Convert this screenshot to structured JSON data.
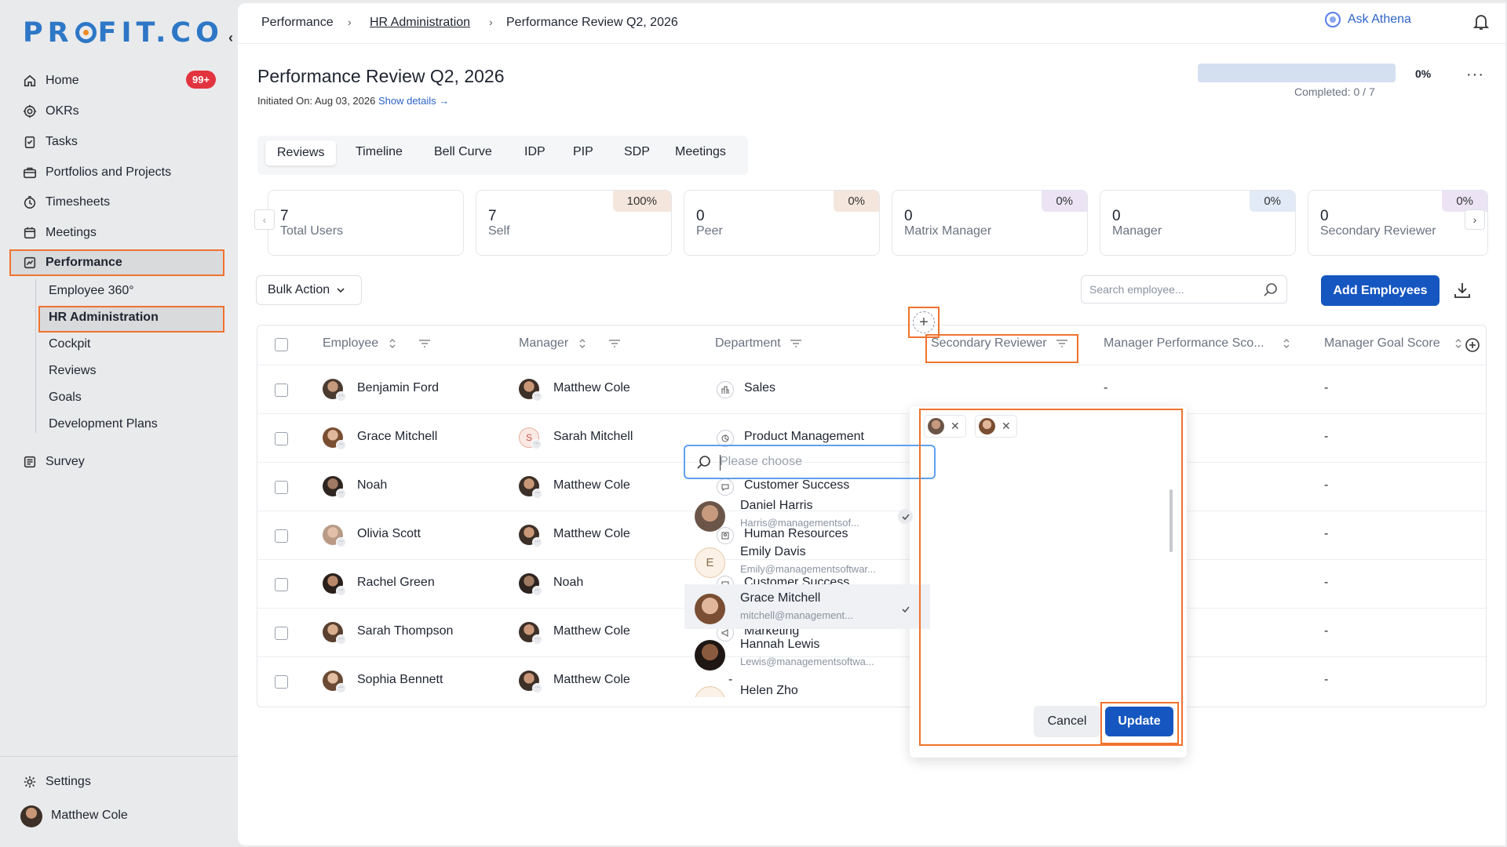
{
  "app": {
    "logo": "PROFIT.CO"
  },
  "sidebar": {
    "home_badge": "99+",
    "items": [
      {
        "label": "Home",
        "icon": "home-icon"
      },
      {
        "label": "OKRs",
        "icon": "target-icon"
      },
      {
        "label": "Tasks",
        "icon": "tasks-icon"
      },
      {
        "label": "Portfolios and Projects",
        "icon": "briefcase-icon"
      },
      {
        "label": "Timesheets",
        "icon": "timer-icon"
      },
      {
        "label": "Meetings",
        "icon": "calendar-icon"
      },
      {
        "label": "Performance",
        "icon": "chart-icon"
      }
    ],
    "sub_items": [
      "Employee 360°",
      "HR Administration",
      "Cockpit",
      "Reviews",
      "Goals",
      "Development Plans"
    ],
    "survey": "Survey",
    "settings": "Settings",
    "user_name": "Matthew Cole"
  },
  "breadcrumb": [
    "Performance",
    "HR Administration",
    "Performance Review Q2, 2026"
  ],
  "topbar": {
    "ask_athena": "Ask Athena"
  },
  "page": {
    "title": "Performance Review Q2, 2026",
    "initiated": "Initiated On: Aug 03, 2026",
    "show_details": "Show details →",
    "progress_pct": "0%",
    "progress_value": 0,
    "completed": "Completed: 0 / 7",
    "more": "···"
  },
  "tabs": [
    "Reviews",
    "Timeline",
    "Bell Curve",
    "IDP",
    "PIP",
    "SDP",
    "Meetings"
  ],
  "cards": [
    {
      "num": "7",
      "label": "Total Users",
      "pct": ""
    },
    {
      "num": "7",
      "label": "Self",
      "pct": "100%",
      "color": "#f4e6dc"
    },
    {
      "num": "0",
      "label": "Peer",
      "pct": "0%",
      "color": "#f4e6dc"
    },
    {
      "num": "0",
      "label": "Matrix Manager",
      "pct": "0%",
      "color": "#ece4f5"
    },
    {
      "num": "0",
      "label": "Manager",
      "pct": "0%",
      "color": "#e1eaf6"
    },
    {
      "num": "0",
      "label": "Secondary Reviewer",
      "pct": "0%",
      "color": "#ece4f5"
    }
  ],
  "toolbar": {
    "bulk_action": "Bulk Action",
    "search_placeholder": "Search employee...",
    "add_employees": "Add Employees"
  },
  "table": {
    "headers": [
      "Employee",
      "Manager",
      "Department",
      "Secondary Reviewer",
      "Manager Performance Sco...",
      "Manager Goal Score"
    ],
    "rows": [
      {
        "employee": "Benjamin Ford",
        "manager": "Matthew Cole",
        "department": "Sales",
        "mps": "-",
        "mgs": "-"
      },
      {
        "employee": "Grace Mitchell",
        "manager": "Sarah Mitchell",
        "department": "Product Management",
        "mps": "",
        "mgs": "-"
      },
      {
        "employee": "Noah",
        "manager": "Matthew Cole",
        "department": "Customer Success",
        "mps": "",
        "mgs": "-"
      },
      {
        "employee": "Olivia Scott",
        "manager": "Matthew Cole",
        "department": "Human Resources",
        "mps": "",
        "mgs": "-"
      },
      {
        "employee": "Rachel Green",
        "manager": "Noah",
        "department": "Customer Success",
        "mps": "",
        "mgs": "-"
      },
      {
        "employee": "Sarah Thompson",
        "manager": "Matthew Cole",
        "department": "Marketing",
        "mps": "",
        "mgs": "-"
      },
      {
        "employee": "Sophia Bennett",
        "manager": "Matthew Cole",
        "department": "-",
        "mps": "",
        "mgs": "-"
      }
    ]
  },
  "dropdown": {
    "placeholder": "Please choose",
    "options": [
      {
        "name": "Daniel Harris",
        "email": "Harris@managementsof...",
        "checked": true
      },
      {
        "name": "Emily Davis",
        "email": "Emily@managementsoftwar...",
        "checked": false,
        "initial": "E"
      },
      {
        "name": "Grace Mitchell",
        "email": "mitchell@management...",
        "checked": true
      },
      {
        "name": "Hannah Lewis",
        "email": "Lewis@managementsoftwa...",
        "checked": false
      },
      {
        "name": "Helen Zho",
        "email": "",
        "checked": false
      }
    ],
    "cancel": "Cancel",
    "update": "Update"
  },
  "colors": {
    "accent": "#1556c0",
    "highlight": "#f0732e",
    "badge": "#e2343f"
  }
}
